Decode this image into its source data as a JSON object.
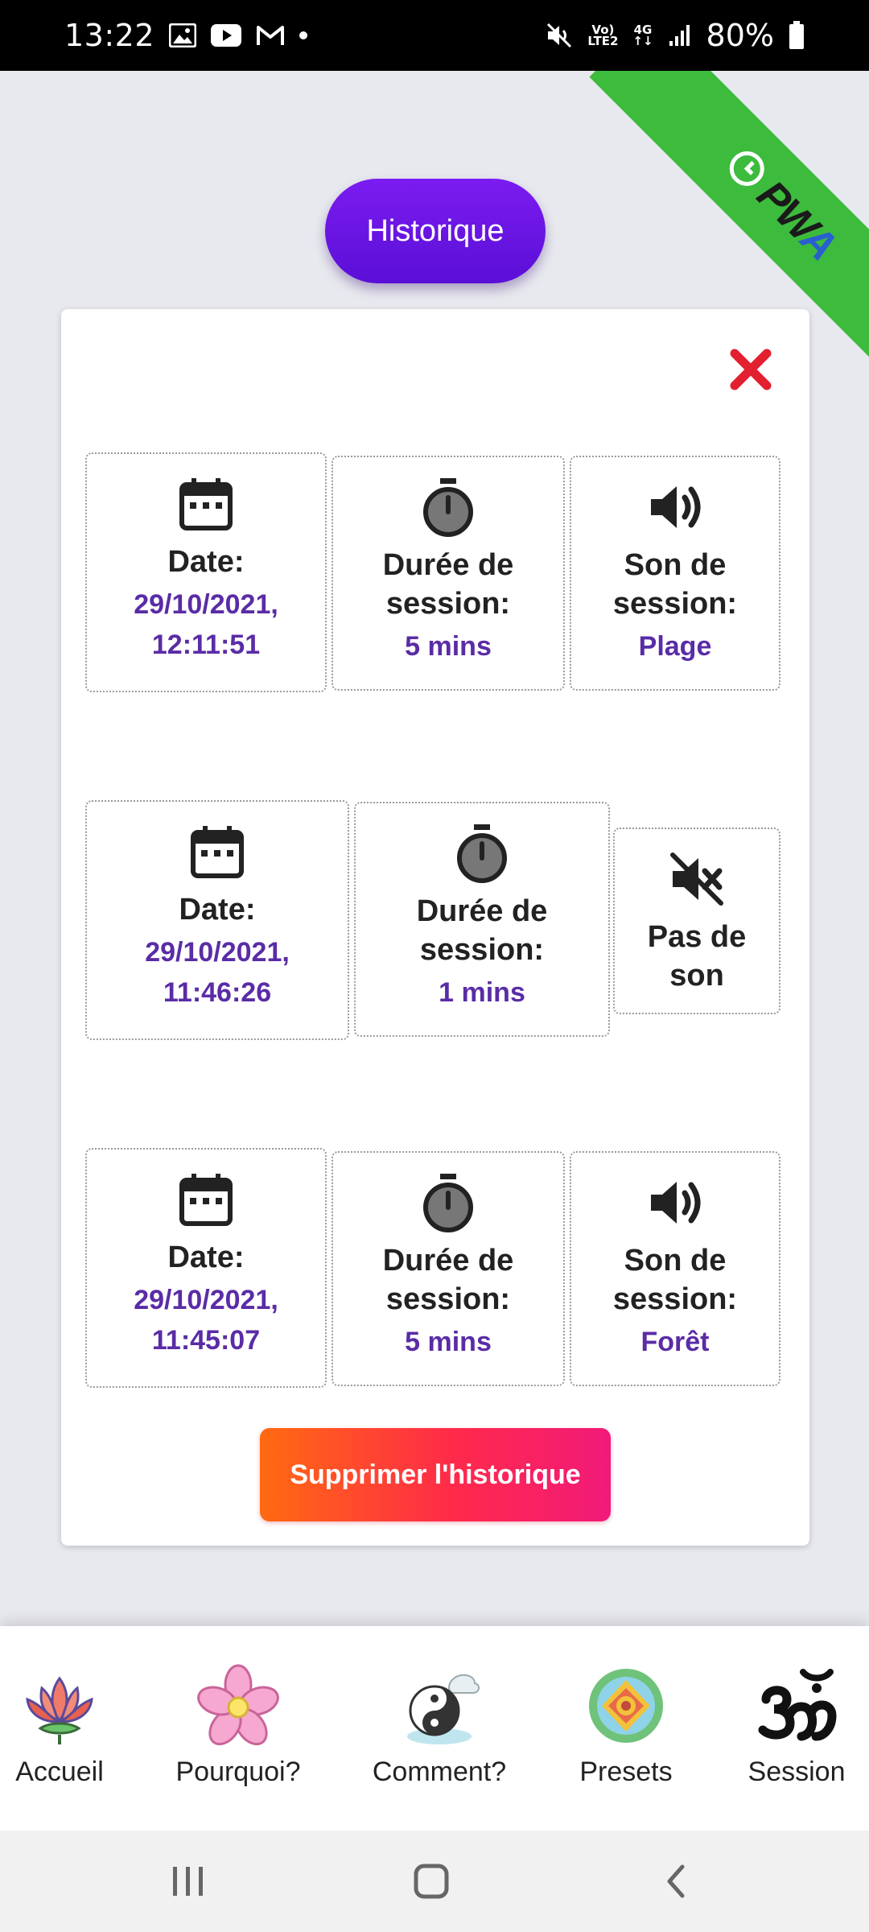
{
  "status_bar": {
    "time": "13:22",
    "battery": "80%",
    "network_top": "Vo)",
    "network_bottom": "LTE2",
    "network_type": "4G"
  },
  "ribbon": {
    "text_pw": "PW",
    "text_a": "A"
  },
  "header": {
    "title": "Historique"
  },
  "history": {
    "entries": [
      {
        "date_label": "Date:",
        "date": "29/10/2021,",
        "time": "12:11:51",
        "duration_label_1": "Durée de",
        "duration_label_2": "session:",
        "duration": "5 mins",
        "sound_label_1": "Son de",
        "sound_label_2": "session:",
        "sound": "Plage"
      },
      {
        "date_label": "Date:",
        "date": "29/10/2021,",
        "time": "11:46:26",
        "duration_label_1": "Durée de",
        "duration_label_2": "session:",
        "duration": "1 mins",
        "sound_label_1": "Pas de",
        "sound_label_2": "son",
        "sound": ""
      },
      {
        "date_label": "Date:",
        "date": "29/10/2021,",
        "time": "11:45:07",
        "duration_label_1": "Durée de",
        "duration_label_2": "session:",
        "duration": "5 mins",
        "sound_label_1": "Son de",
        "sound_label_2": "session:",
        "sound": "Forêt"
      }
    ],
    "delete_label": "Supprimer l'historique"
  },
  "nav": {
    "items": [
      {
        "label": "Accueil"
      },
      {
        "label": "Pourquoi?"
      },
      {
        "label": "Comment?"
      },
      {
        "label": "Presets"
      },
      {
        "label": "Session"
      }
    ]
  },
  "colors": {
    "accent_purple": "#6a14e6",
    "value_text": "#5a2ca6",
    "delete_gradient_start": "#ff6a10",
    "delete_gradient_end": "#f11a7a",
    "ribbon_green": "#3dbb3d",
    "close_red": "#e3202f"
  },
  "icons": {
    "date": "calendar-icon",
    "duration": "stopwatch-icon",
    "sound_on": "volume-icon",
    "sound_off": "volume-mute-icon",
    "close": "close-x-icon"
  }
}
